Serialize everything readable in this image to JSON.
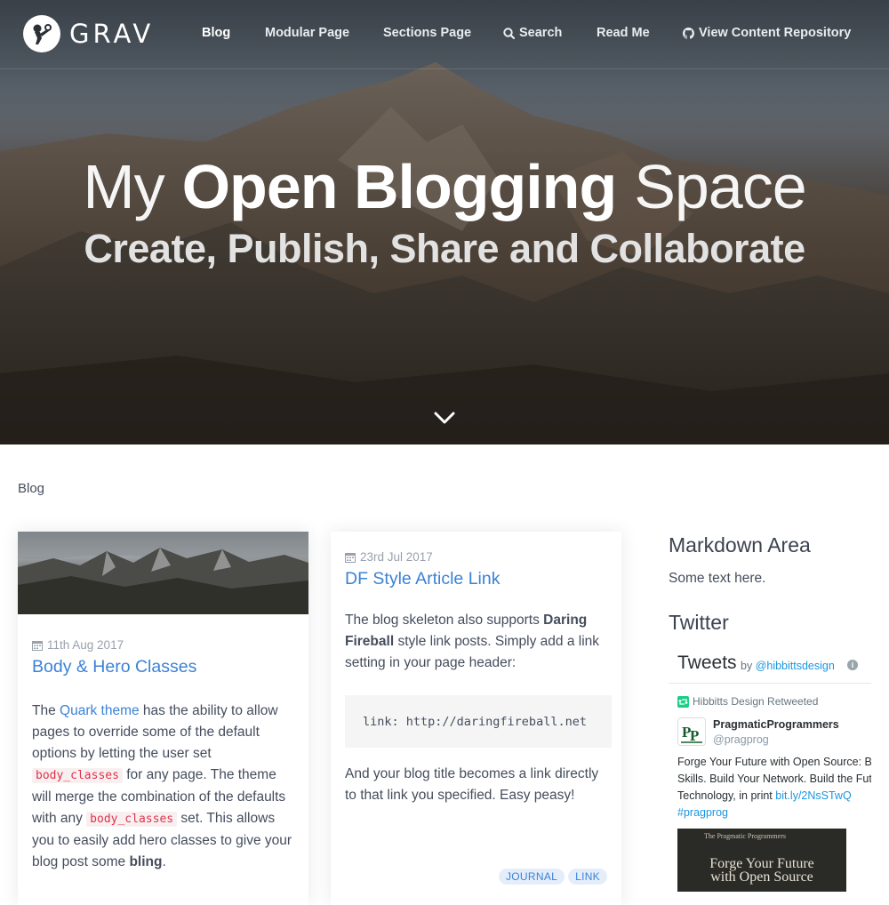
{
  "brand": {
    "name": "GRAV"
  },
  "nav": {
    "items": [
      {
        "label": "Blog",
        "active": true
      },
      {
        "label": "Modular Page"
      },
      {
        "label": "Sections Page"
      },
      {
        "label": "Search",
        "icon": "search-icon"
      },
      {
        "label": "Read Me"
      },
      {
        "label": "View Content Repository",
        "icon": "github-icon"
      }
    ]
  },
  "hero": {
    "title_light_1": "My",
    "title_bold": "Open Blogging",
    "title_light_2": "Space",
    "subtitle": "Create, Publish, Share and Collaborate",
    "scroll_icon": "chevron-down-icon"
  },
  "breadcrumb": "Blog",
  "posts": [
    {
      "date": "11th Aug 2017",
      "title": "Body & Hero Classes",
      "body": {
        "p1": "The ",
        "link": "Quark theme",
        "p2": " has the ability to allow pages to override some of the default options by letting the user set ",
        "code1": "body_classes",
        "p3": " for any page. The theme will merge the combination of the defaults with any ",
        "code2": "body_classes",
        "p4": " set. This allows you to easily add hero classes to give your blog post some ",
        "bold": "bling",
        "p5": "."
      }
    },
    {
      "date": "23rd Jul 2017",
      "title": "DF Style Article Link",
      "body": {
        "p1": "The blog skeleton also supports ",
        "bold1": "Daring Fireball",
        "p2": " style link posts. Simply add a link setting in your page header:"
      },
      "code": "link: http://daringfireball.net",
      "body2": "And your blog title becomes a link directly to that link you specified. Easy peasy!",
      "tags": [
        "JOURNAL",
        "LINK"
      ]
    }
  ],
  "sidebar": {
    "markdown_heading": "Markdown Area",
    "markdown_text": "Some text here.",
    "twitter_heading": "Twitter",
    "twitter": {
      "title": "Tweets",
      "by": "by ",
      "by_handle": "@hibbittsdesign",
      "retweeted": "Hibbitts Design Retweeted",
      "name": "PragmaticProgrammers",
      "handle": "@pragprog",
      "text_line1": "Forge Your Future with Open Source: Bui",
      "text_line2": "Skills. Build Your Network. Build the Futu",
      "text_line3": "Technology, in print ",
      "text_link": "bit.ly/2NsSTwQ",
      "hashtag": "#pragprog",
      "image_small": "The Pragmatic Programmers",
      "image_text_1": "Forge Your Future",
      "image_text_2": "with Open Source"
    }
  },
  "colors": {
    "link": "#3b82d6",
    "tag_bg": "#e4eefb",
    "code_red": "#e0324b"
  }
}
